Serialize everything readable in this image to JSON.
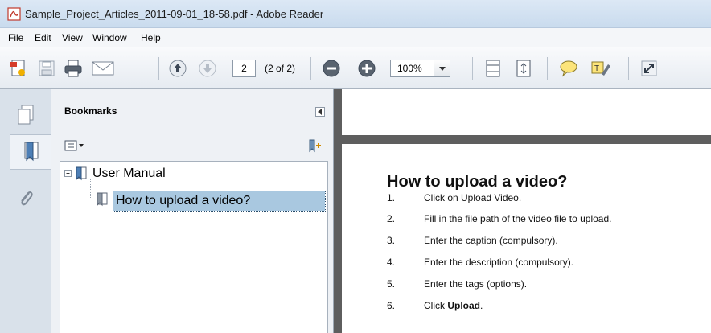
{
  "window": {
    "title": "Sample_Project_Articles_2011-09-01_18-58.pdf - Adobe Reader"
  },
  "menu": [
    "File",
    "Edit",
    "View",
    "Window",
    "Help"
  ],
  "toolbar": {
    "page_number": "2",
    "page_count": "(2 of 2)",
    "zoom": "100%",
    "icons": [
      "create-pdf-icon",
      "save-icon",
      "print-icon",
      "email-icon",
      "previous-page-icon",
      "next-page-icon",
      "zoom-out-icon",
      "zoom-in-icon",
      "fit-page-icon",
      "fit-width-icon",
      "comment-icon",
      "highlight-icon",
      "full-screen-icon"
    ]
  },
  "sidebar": {
    "icons": [
      "pages-icon",
      "bookmarks-icon",
      "attachments-icon"
    ]
  },
  "bookmarks": {
    "title": "Bookmarks",
    "tree": [
      {
        "label": "User Manual",
        "expanded": true
      },
      {
        "label": "How to upload a video?",
        "selected": true
      }
    ]
  },
  "document": {
    "heading": "How to upload a video?",
    "items": [
      {
        "num": "1.",
        "text": "Click on Upload Video."
      },
      {
        "num": "2.",
        "text": "Fill in the file path of the video file to upload."
      },
      {
        "num": "3.",
        "text": "Enter the caption (compulsory)."
      },
      {
        "num": "4.",
        "text": "Enter the description (compulsory)."
      },
      {
        "num": "5.",
        "text": "Enter the tags (options)."
      },
      {
        "num": "6.",
        "text_prefix": "Click ",
        "text_bold": "Upload",
        "text_suffix": "."
      }
    ]
  },
  "colors": {
    "selection": "#a9c8e0",
    "doc_background": "#5e5e5e",
    "toolbar_bg": "#e6ebf1"
  }
}
